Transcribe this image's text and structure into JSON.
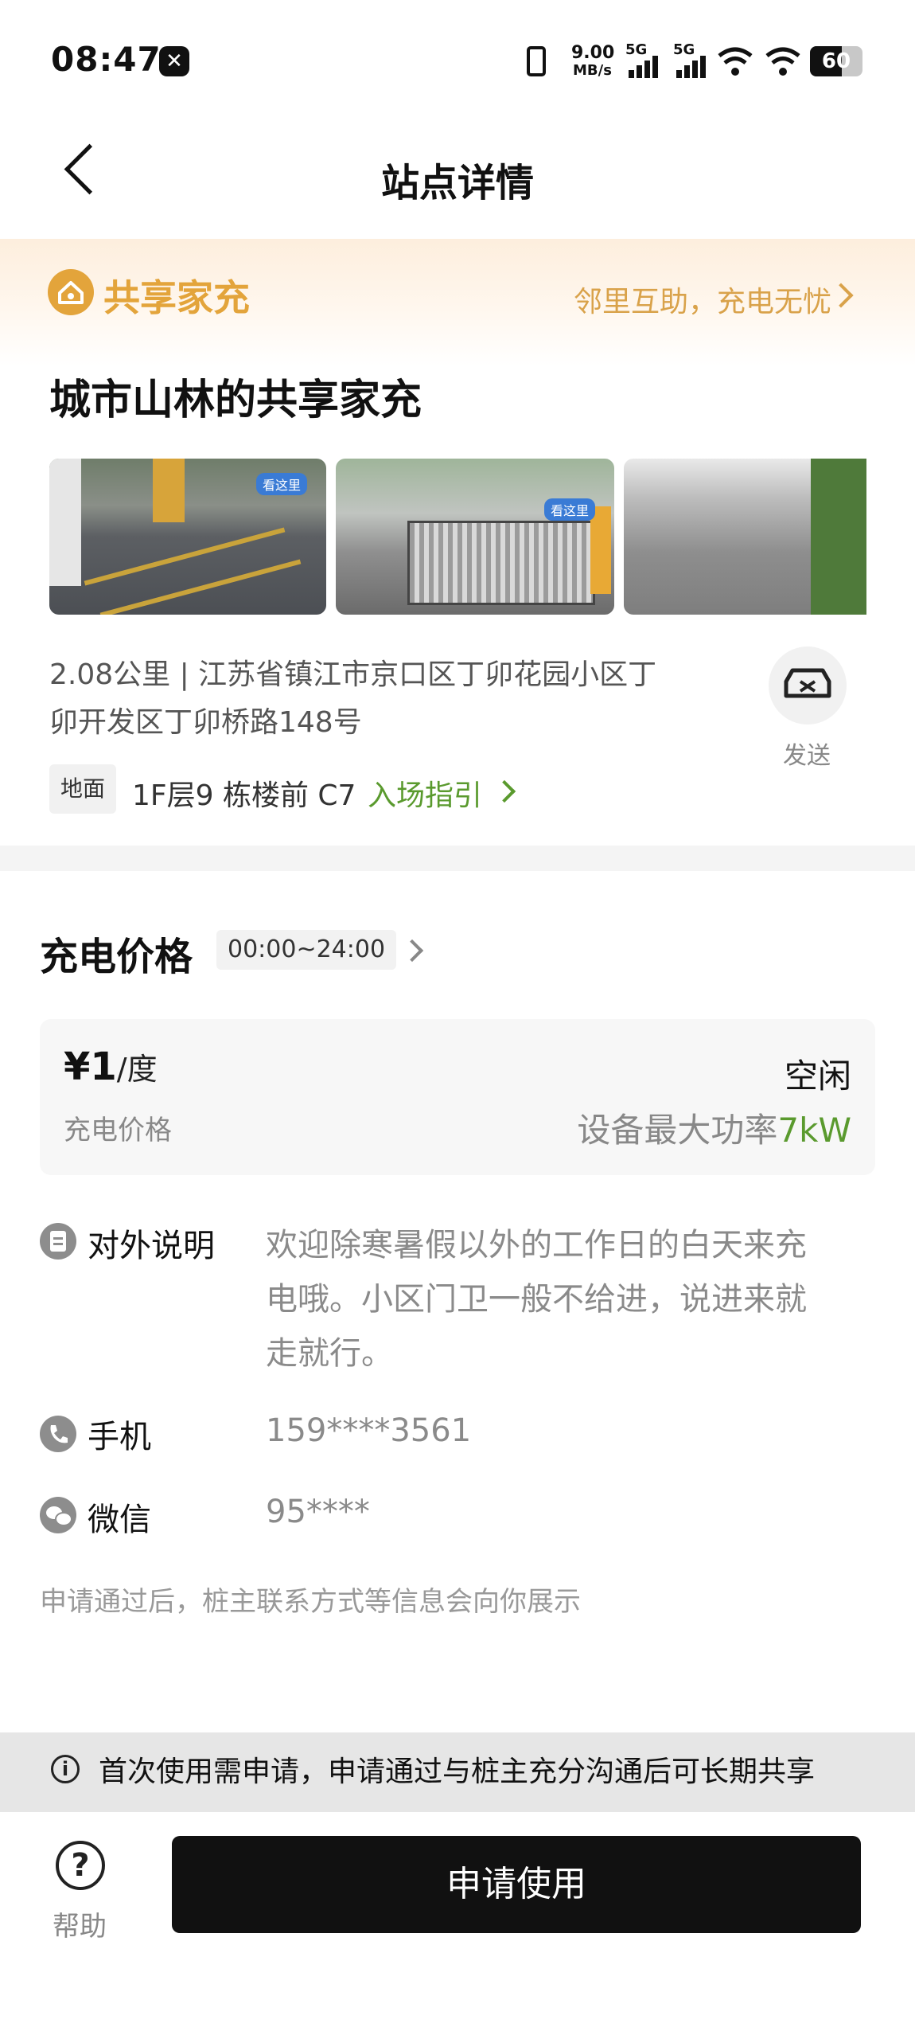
{
  "status_bar": {
    "time": "08:47",
    "net_speed_value": "9.00",
    "net_speed_unit": "MB/s",
    "signal_1": "5G",
    "signal_2": "5G",
    "battery": "60"
  },
  "nav": {
    "title": "站点详情"
  },
  "banner": {
    "title": "共享家充",
    "slogan": "邻里互助，充电无忧"
  },
  "station": {
    "name": "城市山林的共享家充",
    "address_line1": "2.08公里 | 江苏省镇江市京口区丁卯花园小区丁",
    "address_line2": "卯开发区丁卯桥路148号",
    "send_label": "发送",
    "floor_tag": "地面",
    "floor_text": "1F层9 栋楼前 C7",
    "guide_link": "入场指引",
    "photo_badge": "看这里"
  },
  "price": {
    "section_title": "充电价格",
    "time_range": "00:00~24:00",
    "price_value": "¥1",
    "price_unit": "/度",
    "price_label": "充电价格",
    "status": "空闲",
    "power_label": "设备最大功率",
    "power_value": "7kW"
  },
  "info": {
    "desc_label": "对外说明",
    "desc_line1": "欢迎除寒暑假以外的工作日的白天来充",
    "desc_line2": "电哦。小区门卫一般不给进，说进来就",
    "desc_line3": "走就行。",
    "phone_label": "手机",
    "phone_value": "159****3561",
    "wechat_label": "微信",
    "wechat_value": "95****",
    "note": "申请通过后，桩主联系方式等信息会向你展示"
  },
  "notice": {
    "text": "首次使用需申请，申请通过与桩主充分沟通后可长期共享"
  },
  "bottom": {
    "help_label": "帮助",
    "apply_label": "申请使用"
  },
  "colors": {
    "brand_orange": "#e3a43b",
    "accent_green": "#5a9a2e",
    "button_black": "#111111"
  }
}
